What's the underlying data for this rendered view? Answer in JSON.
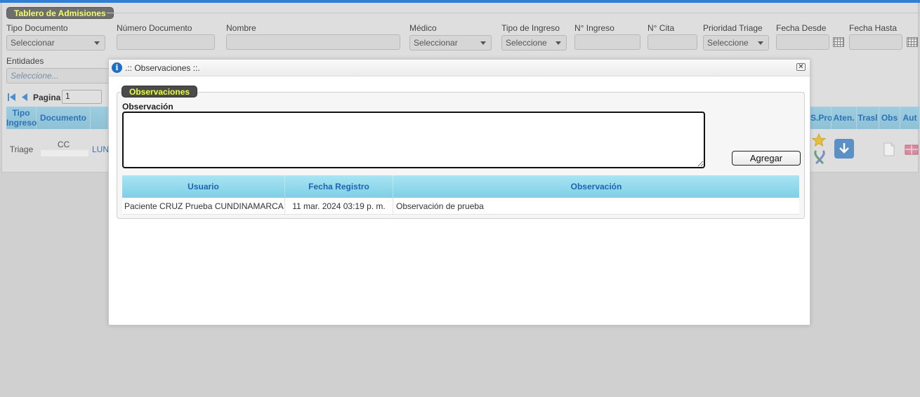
{
  "app": {
    "panel_title": "Tablero de Admisiones"
  },
  "filters": {
    "tipo_documento": {
      "label": "Tipo Documento",
      "value": "Seleccionar"
    },
    "numero_documento": {
      "label": "Número Documento",
      "value": ""
    },
    "nombre": {
      "label": "Nombre",
      "value": ""
    },
    "medico": {
      "label": "Médico",
      "value": "Seleccionar"
    },
    "tipo_ingreso": {
      "label": "Tipo de Ingreso",
      "value": "Seleccione"
    },
    "n_ingreso": {
      "label": "N° Ingreso",
      "value": ""
    },
    "n_cita": {
      "label": "N° Cita",
      "value": ""
    },
    "prioridad_triage": {
      "label": "Prioridad Triage",
      "value": "Seleccione"
    },
    "fecha_desde": {
      "label": "Fecha Desde",
      "value": ""
    },
    "fecha_hasta": {
      "label": "Fecha Hasta",
      "value": ""
    },
    "entidades": {
      "label": "Entidades",
      "placeholder": "Seleccione..."
    }
  },
  "pager": {
    "label": "Pagina",
    "page": "1"
  },
  "grid": {
    "headers": {
      "tipo_ingreso": "Tipo Ingreso",
      "documento": "Documento",
      "s_pro": "S.Pro",
      "aten": "Aten.",
      "trasl": "Trasl",
      "obs": "Obs",
      "aut": "Aut"
    },
    "row": {
      "tipo_ingreso": "Triage",
      "documento": "CC",
      "nombre_partial": "LUN"
    }
  },
  "modal": {
    "title": ".:: Observaciones ::.",
    "section_title": "Observaciones",
    "field_label": "Observación",
    "textarea_value": "",
    "add_button": "Agregar",
    "table": {
      "headers": [
        "Usuario",
        "Fecha Registro",
        "Observación"
      ],
      "rows": [
        [
          "Paciente CRUZ Prueba CUNDINAMARCA",
          "11 mar. 2024 03:19 p. m.",
          "Observación de prueba"
        ]
      ]
    }
  },
  "colors": {
    "topbar": "#2f7fd6",
    "pill_text": "#ecff3a",
    "header_text": "#1d63b4",
    "header_bg": "#8fd6ea"
  },
  "icons": [
    "info-icon",
    "close-icon",
    "calendar-icon",
    "first-page-icon",
    "prev-page-icon",
    "star-icon",
    "ribbon-icon",
    "download-icon",
    "document-icon",
    "gift-icon"
  ]
}
